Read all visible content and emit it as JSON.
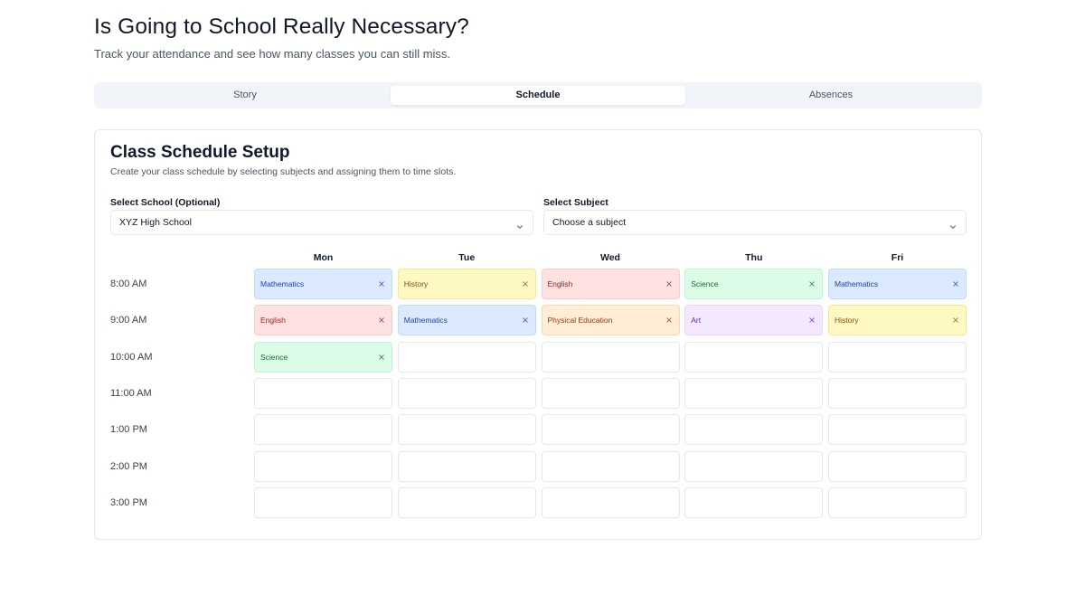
{
  "header": {
    "title": "Is Going to School Really Necessary?",
    "subtitle": "Track your attendance and see how many classes you can still miss."
  },
  "tabs": [
    {
      "label": "Story",
      "active": false
    },
    {
      "label": "Schedule",
      "active": true
    },
    {
      "label": "Absences",
      "active": false
    }
  ],
  "setup": {
    "title": "Class Schedule Setup",
    "description": "Create your class schedule by selecting subjects and assigning them to time slots.",
    "school": {
      "label": "Select School (Optional)",
      "value": "XYZ High School"
    },
    "subject": {
      "label": "Select Subject",
      "placeholder": "Choose a subject"
    }
  },
  "schedule": {
    "days": [
      "Mon",
      "Tue",
      "Wed",
      "Thu",
      "Fri"
    ],
    "times": [
      "8:00 AM",
      "9:00 AM",
      "10:00 AM",
      "11:00 AM",
      "1:00 PM",
      "2:00 PM",
      "3:00 PM"
    ],
    "cells": [
      [
        "Mathematics",
        "History",
        "English",
        "Science",
        "Mathematics"
      ],
      [
        "English",
        "Mathematics",
        "Physical Education",
        "Art",
        "History"
      ],
      [
        "Science",
        "",
        "",
        "",
        ""
      ],
      [
        "",
        "",
        "",
        "",
        ""
      ],
      [
        "",
        "",
        "",
        "",
        ""
      ],
      [
        "",
        "",
        "",
        "",
        ""
      ],
      [
        "",
        "",
        "",
        "",
        ""
      ]
    ]
  },
  "colors": {
    "Mathematics": {
      "bg": "#dbeafe",
      "border": "#bfdbfe",
      "text": "#1e40af"
    },
    "History": {
      "bg": "#fef9c3",
      "border": "#fde68a",
      "text": "#854d0e"
    },
    "English": {
      "bg": "#fee2e2",
      "border": "#fecaca",
      "text": "#991b1b"
    },
    "Science": {
      "bg": "#dcfce7",
      "border": "#bbf7d0",
      "text": "#166534"
    },
    "Physical Education": {
      "bg": "#ffedd5",
      "border": "#fed7aa",
      "text": "#9a3412"
    },
    "Art": {
      "bg": "#f3e8ff",
      "border": "#e9d5ff",
      "text": "#6b21a8"
    }
  },
  "icons": {
    "select_chevron": "chevron-down-icon",
    "remove": "close-icon"
  }
}
